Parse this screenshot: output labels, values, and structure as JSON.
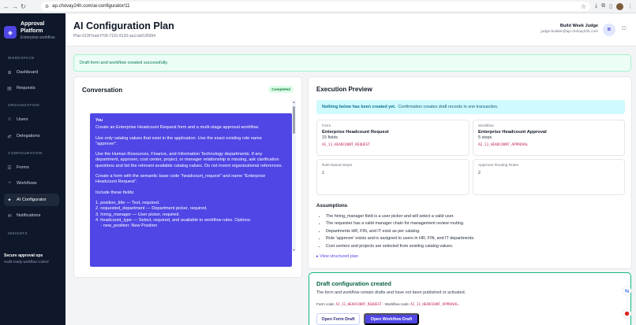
{
  "browser": {
    "url": "ap.chovay24h.com/ai-configurator/11"
  },
  "brand": {
    "name": "Approval Platform",
    "subtitle": "Enterprise workflow"
  },
  "sidebar": {
    "sections": {
      "workspace": "WORKSPACE",
      "organization": "ORGANIZATION",
      "configuration": "CONFIGURATION",
      "insights": "INSIGHTS"
    },
    "items": [
      {
        "label": "Dashboard"
      },
      {
        "label": "Requests"
      },
      {
        "label": "Users"
      },
      {
        "label": "Delegations"
      },
      {
        "label": "Forms"
      },
      {
        "label": "Workflows"
      },
      {
        "label": "AI Configurator"
      },
      {
        "label": "Notifications"
      }
    ],
    "footer": {
      "title": "Secure approval ops",
      "subtitle": "Audit-ready workflow control"
    }
  },
  "header": {
    "title": "AI Configuration Plan",
    "plan_id": "Plan 019f7ead-f709-7191-8130-aa1cde535994",
    "user_name": "Build Week Judge",
    "user_email": "judge.builder@ap.chovay24h.com",
    "avatar": "B"
  },
  "alert": "Draft form and workflow created successfully.",
  "conversation": {
    "title": "Conversation",
    "status": "Completed",
    "sender": "You",
    "paragraphs": [
      "Create an Enterprise Headcount Request form and a multi-stage approval workflow.",
      "Use only catalog values that exist in the application. Use the exact existing role name \"approver\".",
      "Use the Human Resources, Finance, and Information Technology departments. If any department, approver, cost center, project, or manager relationship is missing, ask clarification questions and list the relevant available catalog values. Do not invent organizational references.",
      "Create a form with the semantic base code \"headcount_request\" and name \"Enterprise Headcount Request\".",
      "Include these fields:"
    ],
    "fields": [
      "1. position_title — Text, required.",
      "2. requested_department — Department picker, required.",
      "3. hiring_manager — User picker, required.",
      "4. headcount_type — Select, required, and available to workflow rules. Options:",
      "    - new_position: New Position"
    ]
  },
  "execution": {
    "title": "Execution Preview",
    "info_bold": "Nothing below has been created yet.",
    "info_text": "Confirmation creates draft records in one transaction.",
    "form": {
      "label": "Form",
      "name": "Enterprise Headcount Request",
      "detail": "15 fields",
      "code": "AI_11_HEADCOUNT_REQUEST"
    },
    "workflow": {
      "label": "Workflow",
      "name": "Enterprise Headcount Approval",
      "detail": "5 steps",
      "code": "AI_11_HEADCOUNT_APPROVAL"
    },
    "rule_steps": {
      "label": "Rule-based Steps",
      "value": "1"
    },
    "routing_rules": {
      "label": "Approver Routing Rules",
      "value": "2"
    },
    "assumptions_title": "Assumptions",
    "assumptions": [
      "The hiring_manager field is a user picker and will select a valid user.",
      "The requester has a valid manager chain for management review routing.",
      "Departments HR, FIN, and IT exist as per catalog.",
      "Role 'approver' exists and is assigned to users in HR, FIN, and IT departments.",
      "Cost centers and projects are selected from existing catalog values."
    ],
    "view_plan": "View structured plan"
  },
  "draft": {
    "title": "Draft configuration created",
    "description": "The form and workflow remain drafts and have not been published or activated.",
    "form_code_label": "Form code:",
    "form_code": "AI_11_HEADCOUNT_REQUEST",
    "workflow_code_label": "· Workflow code:",
    "workflow_code": "AI_11_HEADCOUNT_APPROVAL.",
    "open_form": "Open Form Draft",
    "open_workflow": "Open Workflow Draft"
  }
}
